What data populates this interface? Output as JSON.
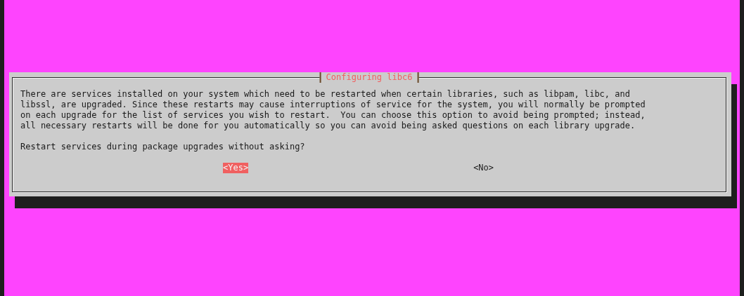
{
  "dialog": {
    "title": "Configuring libc6",
    "message": "There are services installed on your system which need to be restarted when certain libraries, such as libpam, libc, and\nlibssl, are upgraded. Since these restarts may cause interruptions of service for the system, you will normally be prompted\non each upgrade for the list of services you wish to restart.  You can choose this option to avoid being prompted; instead,\nall necessary restarts will be done for you automatically so you can avoid being asked questions on each library upgrade.",
    "question": "Restart services during package upgrades without asking?",
    "buttons": [
      {
        "label": "<Yes>",
        "selected": true
      },
      {
        "label": "<No>",
        "selected": false
      }
    ]
  }
}
